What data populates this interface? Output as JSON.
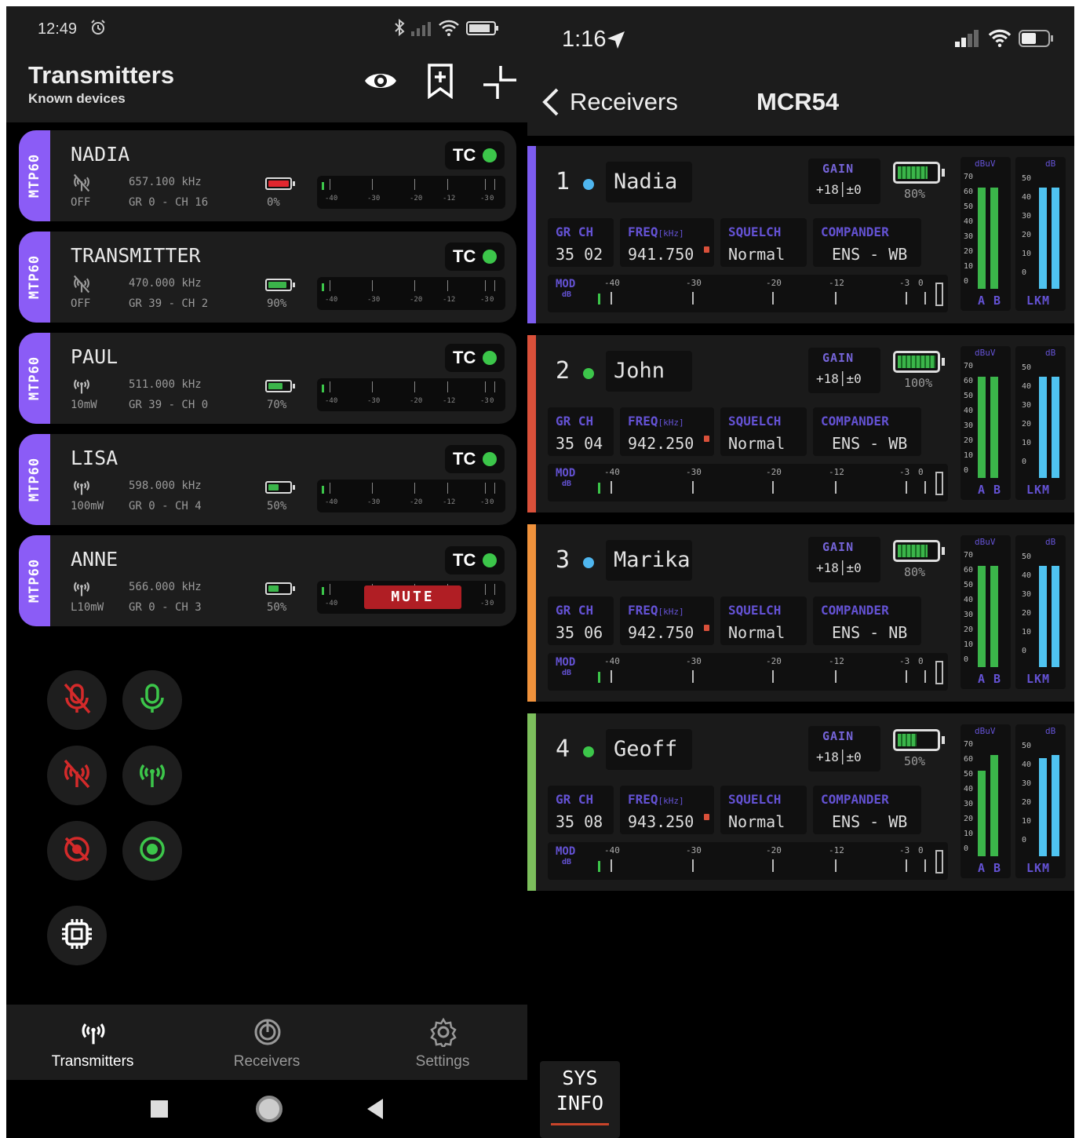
{
  "left": {
    "status": {
      "time": "12:49"
    },
    "header": {
      "title": "Transmitters",
      "subtitle": "Known devices"
    },
    "transmitters": [
      {
        "model": "MTP60",
        "name": "NADIA",
        "power": "OFF",
        "freq": "657.100 kHz",
        "grch": "GR 0 - CH 16",
        "battery": 0,
        "battery_label": "0%",
        "battery_color": "#e0262e",
        "tc": "TC",
        "rf_icon": "antenna-off-icon",
        "muted": false,
        "meter_level": 0.05
      },
      {
        "model": "MTP60",
        "name": "TRANSMITTER",
        "power": "OFF",
        "freq": "470.000 kHz",
        "grch": "GR 39 - CH 2",
        "battery": 90,
        "battery_label": "90%",
        "battery_color": "#3bb54a",
        "tc": "TC",
        "rf_icon": "antenna-off-icon",
        "muted": false,
        "meter_level": 0.05
      },
      {
        "model": "MTP60",
        "name": "PAUL",
        "power": "10mW",
        "freq": "511.000 kHz",
        "grch": "GR 39 - CH 0",
        "battery": 70,
        "battery_label": "70%",
        "battery_color": "#3bb54a",
        "tc": "TC",
        "rf_icon": "antenna-icon",
        "muted": false,
        "meter_level": 0.05
      },
      {
        "model": "MTP60",
        "name": "LISA",
        "power": "100mW",
        "freq": "598.000 kHz",
        "grch": "GR 0 - CH 4",
        "battery": 50,
        "battery_label": "50%",
        "battery_color": "#3bb54a",
        "tc": "TC",
        "rf_icon": "antenna-icon",
        "muted": false,
        "meter_level": 0.05
      },
      {
        "model": "MTP60",
        "name": "ANNE",
        "power": "L10mW",
        "freq": "566.000 kHz",
        "grch": "GR 0 - CH 3",
        "battery": 50,
        "battery_label": "50%",
        "battery_color": "#3bb54a",
        "tc": "TC",
        "rf_icon": "antenna-icon",
        "muted": true,
        "mute_label": "MUTE",
        "meter_level": 0.05
      }
    ],
    "meter_ticks": [
      "-40",
      "-30",
      "-20",
      "-12",
      "-3",
      "0"
    ],
    "nav": {
      "transmitters": "Transmitters",
      "receivers": "Receivers",
      "settings": "Settings"
    }
  },
  "right": {
    "status": {
      "time": "1:16"
    },
    "header": {
      "back": "Receivers",
      "title": "MCR54"
    },
    "receivers": [
      {
        "num": "1",
        "name": "Nadia",
        "dot": "#4fb6ef",
        "strip": "#7c5cf0",
        "gain_label": "GAIN",
        "gain_value": "+18│±0",
        "battery": 80,
        "battery_label": "80%",
        "gr_ch": "35 02",
        "freq": "941.750",
        "squelch": "Normal",
        "compander": "ENS - WB",
        "dbuv_a": 0.95,
        "dbuv_b": 0.95,
        "lkm": 0.95
      },
      {
        "num": "2",
        "name": "John",
        "dot": "#3cc64a",
        "strip": "#d9503a",
        "gain_label": "GAIN",
        "gain_value": "+18│±0",
        "battery": 100,
        "battery_label": "100%",
        "gr_ch": "35 04",
        "freq": "942.250",
        "squelch": "Normal",
        "compander": "ENS - WB",
        "dbuv_a": 0.95,
        "dbuv_b": 0.95,
        "lkm": 0.95
      },
      {
        "num": "3",
        "name": "Marika",
        "dot": "#4fb6ef",
        "strip": "#f0923c",
        "gain_label": "GAIN",
        "gain_value": "+18│±0",
        "battery": 80,
        "battery_label": "80%",
        "gr_ch": "35 06",
        "freq": "942.750",
        "squelch": "Normal",
        "compander": "ENS - NB",
        "dbuv_a": 0.95,
        "dbuv_b": 0.95,
        "lkm": 0.95
      },
      {
        "num": "4",
        "name": "Geoff",
        "dot": "#3cc64a",
        "strip": "#7cbf5c",
        "gain_label": "GAIN",
        "gain_value": "+18│±0",
        "battery": 50,
        "battery_label": "50%",
        "gr_ch": "35 08",
        "freq": "943.250",
        "squelch": "Normal",
        "compander": "ENS - WB",
        "dbuv_a": 0.8,
        "dbuv_b": 0.95,
        "lkm": 0.92
      }
    ],
    "labels": {
      "grch": "GR CH",
      "freq": "FREQ",
      "freq_unit": "[kHz]",
      "squelch": "SQUELCH",
      "compander": "COMPANDER",
      "mod": "MOD",
      "mod_unit": "dB",
      "dbuv": "dBuV",
      "db": "dB",
      "ab": "A B",
      "lkm": "LKM"
    },
    "mod_ticks": [
      "-40",
      "-30",
      "-20",
      "-12",
      "-3",
      "0"
    ],
    "dbuv_scale": [
      "70",
      "60",
      "50",
      "40",
      "30",
      "20",
      "10",
      "0"
    ],
    "db_scale": [
      "50",
      "40",
      "30",
      "20",
      "10",
      "0"
    ],
    "sysinfo": {
      "line1": "SYS",
      "line2": "INFO"
    }
  }
}
